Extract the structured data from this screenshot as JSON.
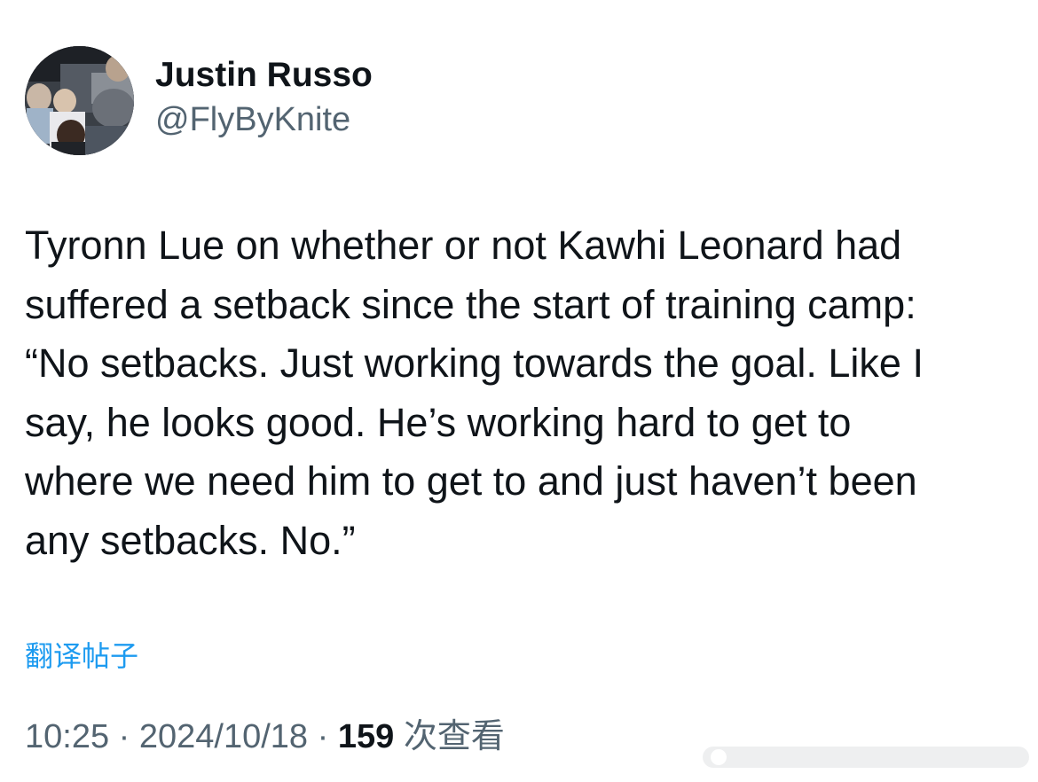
{
  "author": {
    "display_name": "Justin Russo",
    "handle": "@FlyByKnite",
    "avatar_icon": "avatar-photo"
  },
  "tweet": {
    "lines": [
      "Tyronn Lue on whether or not Kawhi Leonard had",
      "suffered a setback since the start of training camp:",
      "“No setbacks. Just working towards the goal. Like I",
      "say, he looks good. He’s working hard to get to",
      "where we need him to get to and just haven’t been",
      "any setbacks. No.”"
    ]
  },
  "translate_label": "翻译帖子",
  "meta": {
    "time": "10:25",
    "separator": " · ",
    "date": "2024/10/18",
    "views_count": "159",
    "views_label": "次查看"
  },
  "colors": {
    "text": "#0f1419",
    "secondary": "#536471",
    "link": "#1d9bf0"
  }
}
